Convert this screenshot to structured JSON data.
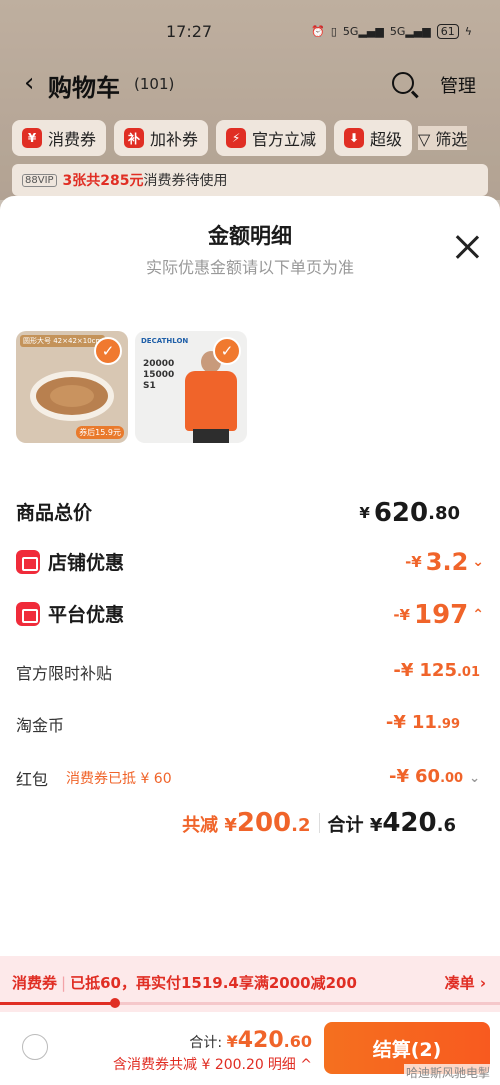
{
  "status": {
    "time": "17:27",
    "battery": "61"
  },
  "header": {
    "title": "购物车",
    "count": "(101)",
    "manage": "管理"
  },
  "chips": [
    {
      "icon": "¥",
      "label": "消费券"
    },
    {
      "icon": "补",
      "label": "加补券"
    },
    {
      "icon": "⚡",
      "label": "官方立减"
    },
    {
      "icon": "⬇",
      "label": "超级"
    }
  ],
  "filter": "筛选",
  "vip": {
    "badge": "88VIP",
    "count": "3张共285元",
    "text": "消费券待使用"
  },
  "sheet": {
    "title": "金额明细",
    "subtitle": "实际优惠金额请以下单页为准",
    "products": [
      {
        "tag": "圆形大号 42×42×10cm",
        "price": "券后15.9元"
      },
      {
        "brand": "DECATHLON",
        "stat1": "20000",
        "stat2": "15000",
        "stat3": "S1"
      }
    ],
    "total_price": {
      "label": "商品总价",
      "currency": "¥",
      "int": "620",
      "dec": ".80"
    },
    "shop_discount": {
      "label": "店铺优惠",
      "prefix": "-¥",
      "value": "3.2"
    },
    "platform_discount": {
      "label": "平台优惠",
      "prefix": "-¥",
      "value": "197"
    },
    "subsidy": {
      "label": "官方限时补贴",
      "prefix": "-¥",
      "int": "125",
      "dec": ".01"
    },
    "coin": {
      "label": "淘金币",
      "prefix": "-¥",
      "int": "11",
      "dec": ".99"
    },
    "redpacket": {
      "label": "红包",
      "note": "消费券已抵 ¥ 60",
      "prefix": "-¥",
      "int": "60",
      "dec": ".00"
    },
    "summary": {
      "save_label": "共减",
      "save_currency": "¥",
      "save_int": "200",
      "save_dec": ".2",
      "sum_label": "合计",
      "sum_currency": "¥",
      "sum_int": "420",
      "sum_dec": ".6"
    }
  },
  "couponbar": {
    "label": "消费券",
    "text": "已抵60，再实付1519.4享满2000减200",
    "action": "凑单 ›",
    "progress": 0.23
  },
  "bottom": {
    "total_label": "合计: ",
    "total_currency": "¥",
    "total_int": "420",
    "total_dec": ".60",
    "save_text": "含消费券共减 ¥ 200.20",
    "detail": "明细 ^",
    "checkout": "结算(2)"
  },
  "watermark": "哈迪斯风驰电掣",
  "colors": {
    "accent": "#f0642a",
    "red": "#e02e24",
    "checkout": "#f5701f"
  }
}
